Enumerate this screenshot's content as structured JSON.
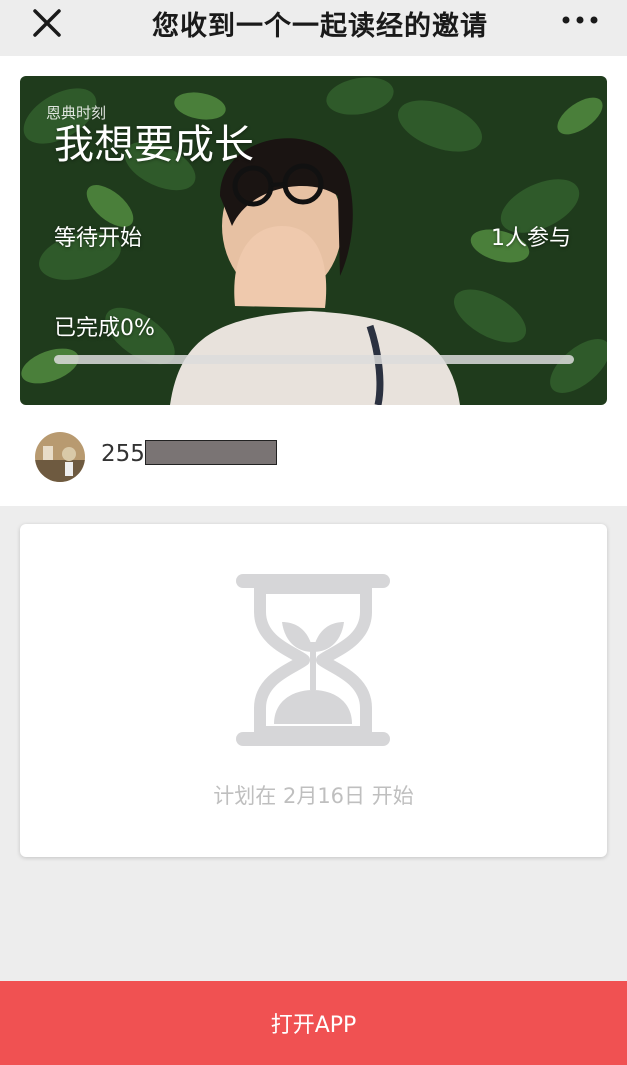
{
  "nav": {
    "title": "您收到一个一起读经的邀请",
    "close_icon": "close-icon",
    "more_icon": "more-icon"
  },
  "plan": {
    "brand": "恩典时刻",
    "title": "我想要成长",
    "status": "等待开始",
    "participants": "1人参与",
    "progress_label": "已完成0%",
    "progress_value": 0
  },
  "user": {
    "name": "255"
  },
  "schedule": {
    "start_text": "计划在 2月16日 开始",
    "icon": "hourglass-icon"
  },
  "footer": {
    "open_app_label": "打开APP"
  },
  "colors": {
    "accent": "#f05152",
    "background": "#ededed",
    "muted_text": "#bfbfbf"
  }
}
